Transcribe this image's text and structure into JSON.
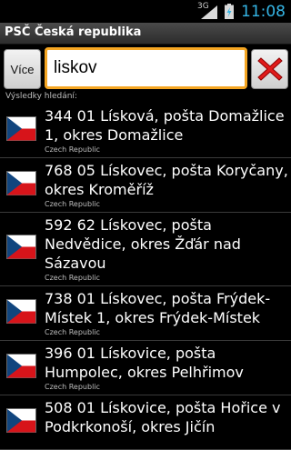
{
  "status_bar": {
    "signal_label": "3G",
    "time": "11:08"
  },
  "app": {
    "title": "PSČ Česká republika"
  },
  "search": {
    "more_button_label": "Více",
    "query": "liskov",
    "clear_icon": "red-x-icon"
  },
  "results": {
    "label": "Výsledky hledání:",
    "flag_icon": "czech-flag-icon",
    "items": [
      {
        "lines": [
          "344 01 Lísková, pošta Domažlice",
          "1, okres Domažlice"
        ],
        "country": "Czech Republic"
      },
      {
        "lines": [
          "768 05 Lískovec, pošta Koryčany,",
          "okres Kroměříž"
        ],
        "country": "Czech Republic"
      },
      {
        "lines": [
          "592 62 Lískovec, pošta",
          "Nedvědice, okres Žďár nad",
          "Sázavou"
        ],
        "country": "Czech Republic"
      },
      {
        "lines": [
          "738 01 Lískovec, pošta Frýdek-",
          "Místek 1, okres Frýdek-Místek"
        ],
        "country": "Czech Republic"
      },
      {
        "lines": [
          "396 01 Lískovice, pošta",
          "Humpolec, okres Pelhřimov"
        ],
        "country": "Czech Republic"
      },
      {
        "lines": [
          "508 01 Lískovice, pošta Hořice v",
          "Podkrkonoší, okres Jičín"
        ],
        "country": ""
      }
    ]
  },
  "colors": {
    "accent_clock": "#35b5e5",
    "input_border": "#f5a623",
    "clear_icon": "#e11b1b"
  }
}
